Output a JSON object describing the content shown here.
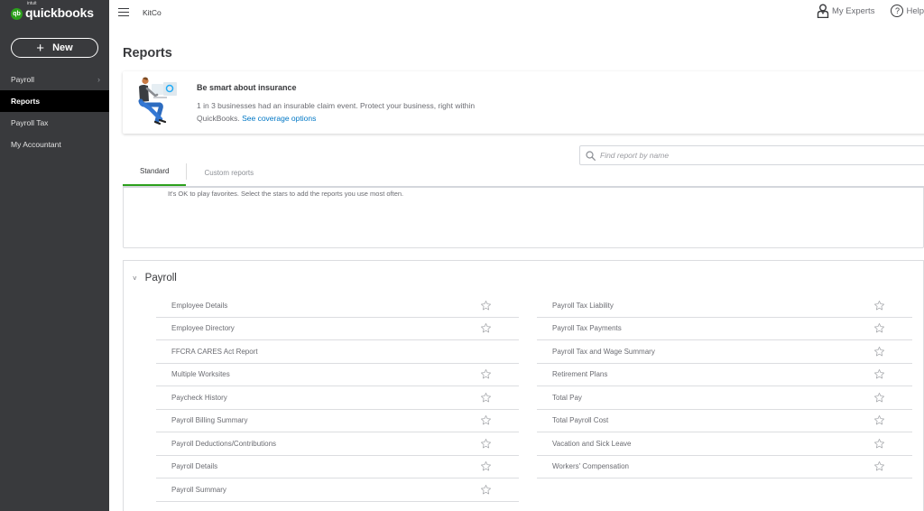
{
  "brand": {
    "intuit": "intuit",
    "name": "quickbooks",
    "mark": "qb",
    "color": "#2ca01c"
  },
  "sidebar": {
    "new_label": "New",
    "items": [
      {
        "label": "Payroll",
        "has_chevron": true,
        "active": false
      },
      {
        "label": "Reports",
        "has_chevron": false,
        "active": true
      },
      {
        "label": "Payroll Tax",
        "has_chevron": false,
        "active": false
      },
      {
        "label": "My Accountant",
        "has_chevron": false,
        "active": false
      }
    ]
  },
  "topbar": {
    "company": "KitCo",
    "my_experts": "My Experts",
    "help": "Help",
    "help_glyph": "?"
  },
  "page": {
    "title": "Reports"
  },
  "banner": {
    "title": "Be smart about insurance",
    "text": "1 in 3 businesses had an insurable claim event. Protect your business, right within QuickBooks.",
    "link": "See coverage options"
  },
  "search": {
    "placeholder": "Find report by name",
    "value": ""
  },
  "tabs": [
    {
      "label": "Standard",
      "active": true
    },
    {
      "label": "Custom reports",
      "active": false
    }
  ],
  "favorites": {
    "message": "It's OK to play favorites. Select the stars to add the reports you use most often."
  },
  "payroll_section": {
    "title": "Payroll",
    "chevron": "˅",
    "left": [
      {
        "label": "Employee Details",
        "star": true
      },
      {
        "label": "Employee Directory",
        "star": true
      },
      {
        "label": "FFCRA CARES Act Report",
        "star": false
      },
      {
        "label": "Multiple Worksites",
        "star": true
      },
      {
        "label": "Paycheck History",
        "star": true
      },
      {
        "label": "Payroll Billing Summary",
        "star": true
      },
      {
        "label": "Payroll Deductions/Contributions",
        "star": true
      },
      {
        "label": "Payroll Details",
        "star": true
      },
      {
        "label": "Payroll Summary",
        "star": true
      }
    ],
    "right": [
      {
        "label": "Payroll Tax Liability",
        "star": true
      },
      {
        "label": "Payroll Tax Payments",
        "star": true
      },
      {
        "label": "Payroll Tax and Wage Summary",
        "star": true
      },
      {
        "label": "Retirement Plans",
        "star": true
      },
      {
        "label": "Total Pay",
        "star": true
      },
      {
        "label": "Total Payroll Cost",
        "star": true
      },
      {
        "label": "Vacation and Sick Leave",
        "star": true
      },
      {
        "label": "Workers' Compensation",
        "star": true
      }
    ]
  },
  "icons": {
    "logo": "quickbooks-logo-icon",
    "plus": "plus-icon",
    "chevron_right": "chevron-right-icon",
    "menu": "hamburger-menu-icon",
    "person": "person-icon",
    "help": "help-circle-icon",
    "search": "search-icon",
    "star": "star-outline-icon",
    "chevron_down": "chevron-down-icon"
  }
}
